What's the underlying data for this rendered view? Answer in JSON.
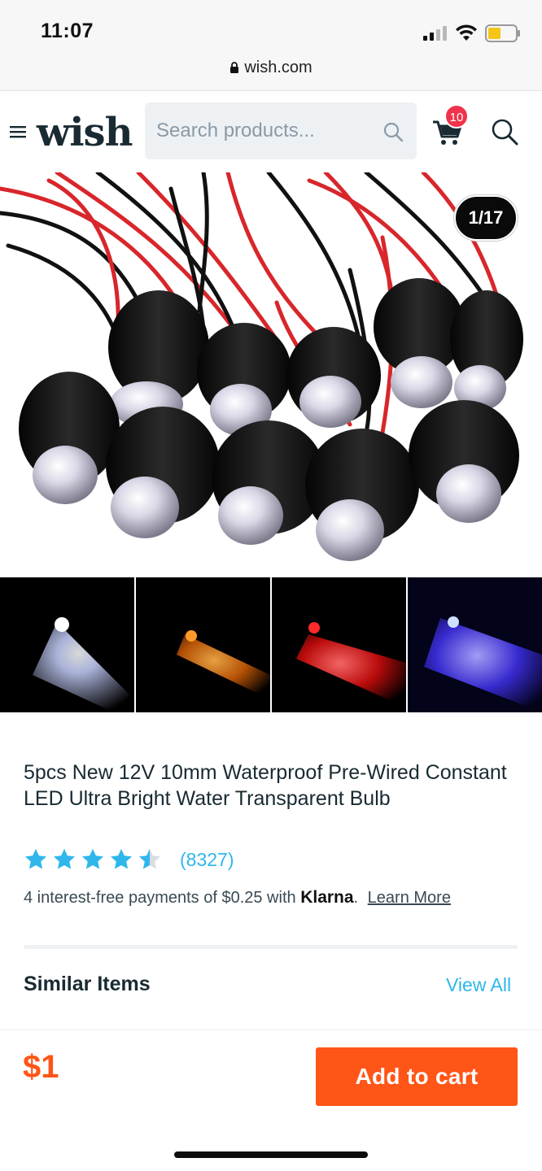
{
  "status_bar": {
    "time": "11:07"
  },
  "url_bar": {
    "domain": "wish.com"
  },
  "header": {
    "logo": "wish",
    "search_placeholder": "Search products...",
    "cart_count": "10"
  },
  "gallery": {
    "counter": "1/17",
    "main_image": "black-led-bulbs-with-red-black-wires",
    "thumbnails": [
      {
        "name": "white-led-thumbnail",
        "color": "#eef2ff"
      },
      {
        "name": "orange-led-thumbnail",
        "color": "#ff8a1a"
      },
      {
        "name": "red-led-thumbnail",
        "color": "#ff2a2a"
      },
      {
        "name": "blue-led-thumbnail",
        "color": "#6a5cff"
      }
    ]
  },
  "product": {
    "title": "5pcs New 12V 10mm Waterproof Pre-Wired Constant LED Ultra Bright Water Transparent Bulb",
    "rating": 4.5,
    "review_count": "(8327)",
    "klarna_prefix": "4 interest-free payments of $0.25 with ",
    "klarna_brand": "Klarna",
    "klarna_suffix": ".",
    "learn_more": "Learn More"
  },
  "similar": {
    "title": "Similar Items",
    "view_all": "View All"
  },
  "purchase": {
    "price": "$1",
    "add_to_cart": "Add to cart"
  },
  "colors": {
    "accent_orange": "#ff5517",
    "link_blue": "#2fb7ec",
    "badge_red": "#f0334b",
    "text_dark": "#192a32"
  }
}
